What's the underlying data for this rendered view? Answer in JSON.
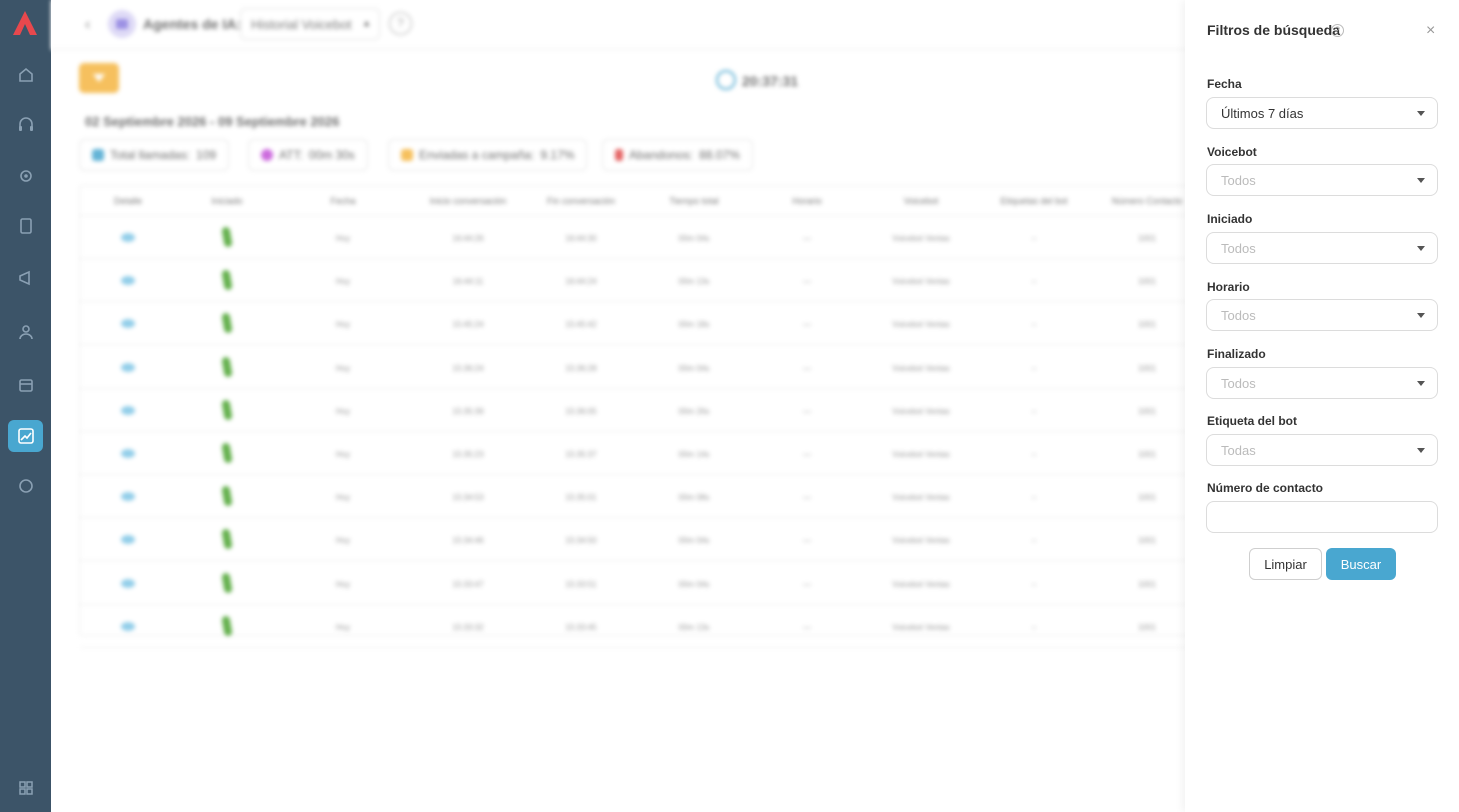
{
  "sidebar": {
    "items": [
      {
        "icon": "home-icon"
      },
      {
        "icon": "headset-icon"
      },
      {
        "icon": "settings-icon"
      },
      {
        "icon": "document-icon"
      },
      {
        "icon": "megaphone-icon"
      },
      {
        "icon": "user-icon"
      },
      {
        "icon": "calendar-icon"
      },
      {
        "icon": "chart-icon",
        "active": true
      },
      {
        "icon": "integration-icon"
      }
    ],
    "bottom_icon": "apps-icon"
  },
  "header": {
    "title": "Agentes de IA:",
    "view_select": "Historial Voicebot",
    "help": "?"
  },
  "clock_time": "20:37:31",
  "date_range": "02 Septiembre 2026 - 09 Septiembre 2026",
  "stats": [
    {
      "label": "Total llamadas:",
      "value": "109",
      "color": "#49a7d0"
    },
    {
      "label": "ATT:",
      "value": "00m 30s",
      "color": "#c452d8"
    },
    {
      "label": "Enviadas a campaña:",
      "value": "9.17%",
      "color": "#f5b642"
    },
    {
      "label": "Abandonos:",
      "value": "88.07%",
      "color": "#e04848"
    }
  ],
  "table": {
    "columns": [
      "Detalle",
      "Iniciado",
      "Fecha",
      "Inicio conversación",
      "Fin conversación",
      "Tiempo total",
      "Horario",
      "Voicebot",
      "Etiquetas del bot",
      "Número Contacto"
    ],
    "rows": [
      [
        "Hoy",
        "16:44:26",
        "16:44:30",
        "00m 04s",
        "—",
        "Voicebot Ventas",
        "–",
        "1001"
      ],
      [
        "Hoy",
        "16:44:11",
        "16:44:24",
        "00m 13s",
        "—",
        "Voicebot Ventas",
        "–",
        "1001"
      ],
      [
        "Hoy",
        "15:45:24",
        "15:45:42",
        "00m 18s",
        "—",
        "Voicebot Ventas",
        "–",
        "1001"
      ],
      [
        "Hoy",
        "15:36:24",
        "15:36:28",
        "00m 04s",
        "—",
        "Voicebot Ventas",
        "–",
        "1001"
      ],
      [
        "Hoy",
        "15:35:39",
        "15:36:05",
        "00m 26s",
        "—",
        "Voicebot Ventas",
        "–",
        "1001"
      ],
      [
        "Hoy",
        "15:35:23",
        "15:35:37",
        "00m 14s",
        "—",
        "Voicebot Ventas",
        "–",
        "1001"
      ],
      [
        "Hoy",
        "15:34:53",
        "15:35:01",
        "00m 08s",
        "—",
        "Voicebot Ventas",
        "–",
        "1001"
      ],
      [
        "Hoy",
        "15:34:46",
        "15:34:50",
        "00m 04s",
        "—",
        "Voicebot Ventas",
        "–",
        "1001"
      ],
      [
        "Hoy",
        "15:33:47",
        "15:33:51",
        "00m 04s",
        "—",
        "Voicebot Ventas",
        "–",
        "1001"
      ],
      [
        "Hoy",
        "15:33:32",
        "15:33:45",
        "00m 13s",
        "—",
        "Voicebot Ventas",
        "–",
        "1001"
      ]
    ]
  },
  "filters_panel": {
    "title": "Filtros de búsqueda",
    "help": "?",
    "close": "×",
    "fields": [
      {
        "label": "Fecha",
        "value": "Últimos 7 días"
      },
      {
        "label": "Voicebot",
        "placeholder": "Todos"
      },
      {
        "label": "Iniciado",
        "placeholder": "Todos"
      },
      {
        "label": "Horario",
        "placeholder": "Todos"
      },
      {
        "label": "Finalizado",
        "placeholder": "Todos"
      },
      {
        "label": "Etiqueta del bot",
        "placeholder": "Todas"
      }
    ],
    "contact_label": "Número de contacto",
    "contact_value": "",
    "clear_label": "Limpiar",
    "search_label": "Buscar"
  }
}
